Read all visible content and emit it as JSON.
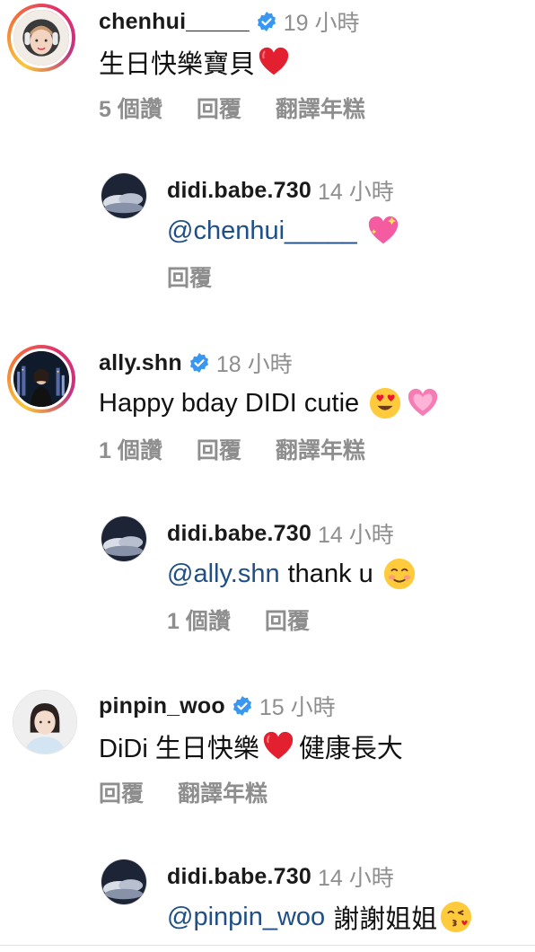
{
  "comments": [
    {
      "username": "chenhui_____",
      "time": "19 小時",
      "text": "生日快樂寶貝",
      "emoji": "red-heart",
      "likes": "5 個讚",
      "reply": "回覆",
      "translate": "翻譯年糕"
    },
    {
      "username": "didi.babe.730",
      "time": "14 小時",
      "mention": "@chenhui_____",
      "text": "",
      "emoji": "sparkling-heart",
      "reply": "回覆"
    },
    {
      "username": "ally.shn",
      "time": "18 小時",
      "text": "Happy bday DIDI cutie",
      "emoji": [
        "heart-eyes",
        "pink-heart"
      ],
      "likes": "1 個讚",
      "reply": "回覆",
      "translate": "翻譯年糕"
    },
    {
      "username": "didi.babe.730",
      "time": "14 小時",
      "mention": "@ally.shn",
      "text": "thank u",
      "emoji": "smiling-blush",
      "likes": "1 個讚",
      "reply": "回覆"
    },
    {
      "username": "pinpin_woo",
      "time": "15 小時",
      "text_a": "DiDi 生日快樂",
      "emoji": "red-heart",
      "text_b": "健康長大",
      "reply": "回覆",
      "translate": "翻譯年糕"
    },
    {
      "username": "didi.babe.730",
      "time": "14 小時",
      "mention": "@pinpin_woo",
      "text": "謝謝姐姐",
      "emoji": "kissing-face"
    }
  ],
  "colors": {
    "verified": "#3897f0",
    "mention": "#1f4f86",
    "meta_gray": "#8e8e8e"
  }
}
